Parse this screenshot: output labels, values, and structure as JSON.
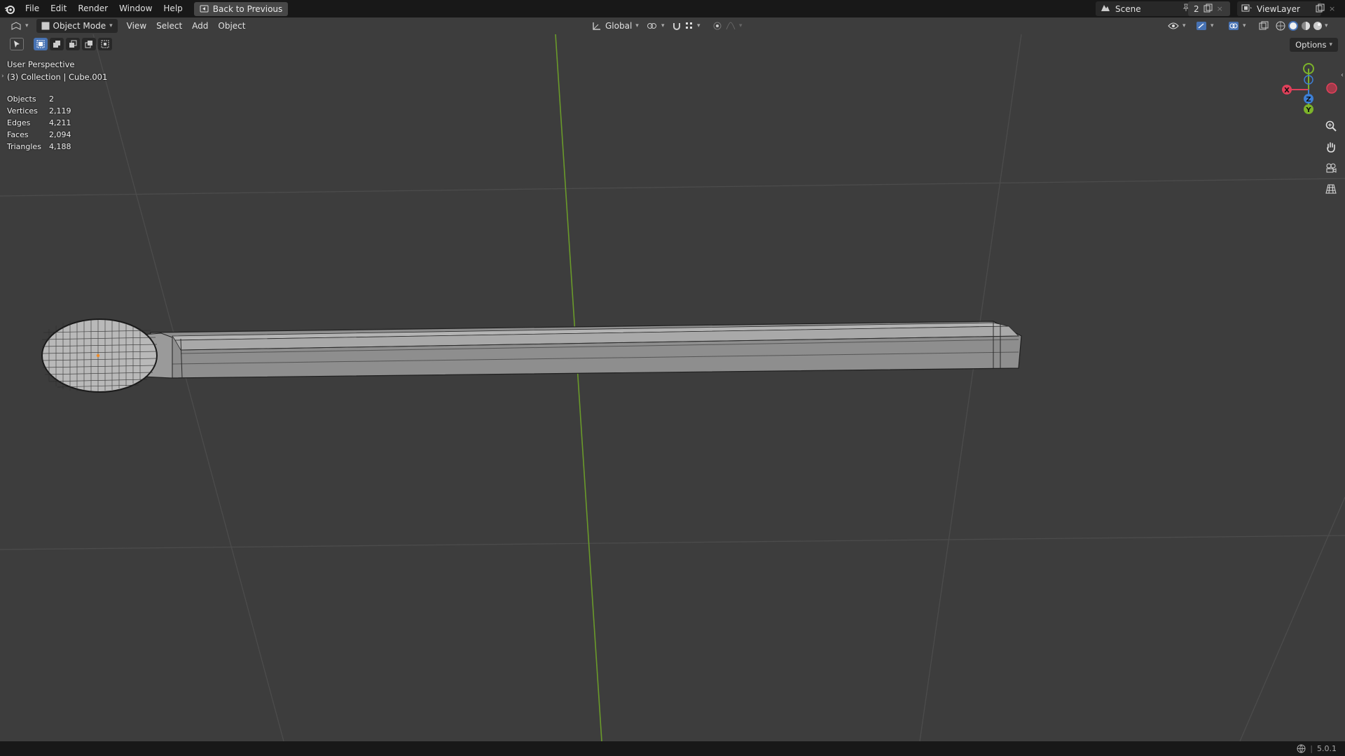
{
  "menu": {
    "file": "File",
    "edit": "Edit",
    "render": "Render",
    "window": "Window",
    "help": "Help",
    "back": "Back to Previous"
  },
  "scene": {
    "name": "Scene",
    "users": "2",
    "view_layer": "ViewLayer"
  },
  "header": {
    "mode": "Object Mode",
    "view": "View",
    "select": "Select",
    "add": "Add",
    "object": "Object",
    "orientation": "Global",
    "options": "Options"
  },
  "overlay": {
    "perspective": "User Perspective",
    "collection": "(3) Collection | Cube.001"
  },
  "stats": [
    {
      "label": "Objects",
      "value": "2"
    },
    {
      "label": "Vertices",
      "value": "2,119"
    },
    {
      "label": "Edges",
      "value": "4,211"
    },
    {
      "label": "Faces",
      "value": "2,094"
    },
    {
      "label": "Triangles",
      "value": "4,188"
    }
  ],
  "gizmo": {
    "x": "X",
    "y": "Y",
    "z": "Z"
  },
  "status": {
    "version": "5.0.1"
  },
  "colors": {
    "accent": "#4772b3",
    "x_axis": "#e0405a",
    "y_axis": "#7cb32a",
    "z_axis": "#3d7fd6",
    "grid": "#545454",
    "bg": "#3d3d3d"
  },
  "icons": [
    "blender-logo-icon",
    "back-icon",
    "scene-icon",
    "pin-icon",
    "new-scene-icon",
    "view-layer-icon",
    "editor-type-icon",
    "object-mode-icon",
    "transform-orientation-icon",
    "pivot-icon",
    "snap-icon",
    "proportional-icon",
    "visibility-icon",
    "gizmo-icon",
    "overlay-icon",
    "xray-icon",
    "wireframe-shading-icon",
    "solid-shading-icon",
    "material-shading-icon",
    "render-shading-icon",
    "zoom-icon",
    "pan-hand-icon",
    "camera-icon",
    "grid-icon",
    "globe-icon"
  ]
}
